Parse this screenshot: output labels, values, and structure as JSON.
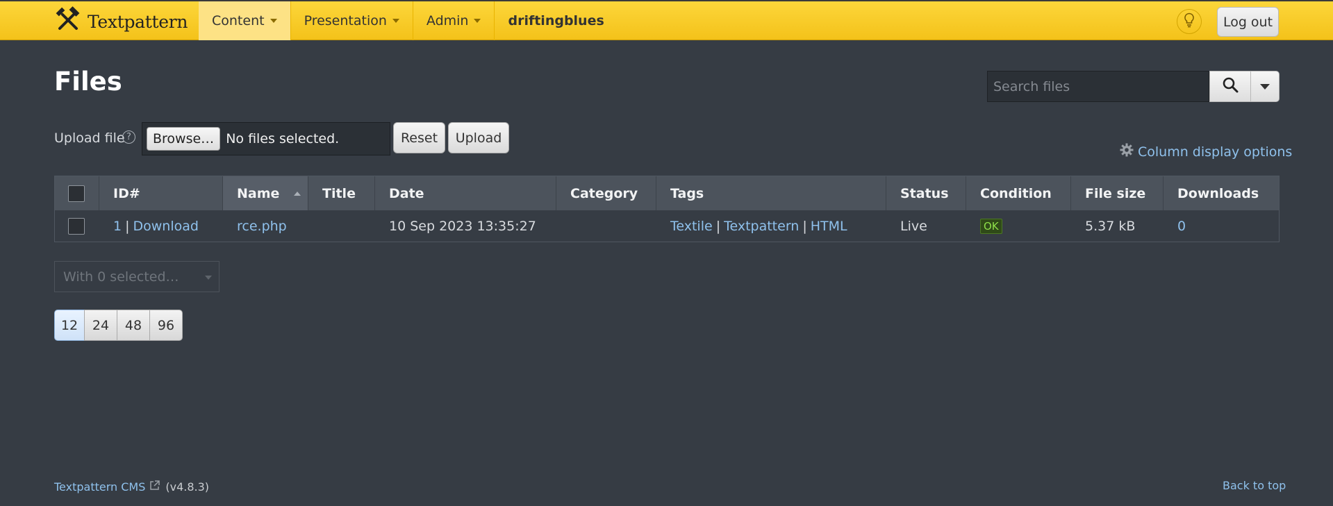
{
  "header": {
    "brand": "Textpattern",
    "nav": [
      {
        "label": "Content"
      },
      {
        "label": "Presentation"
      },
      {
        "label": "Admin"
      }
    ],
    "site_name": "driftingblues",
    "logout_label": "Log out",
    "brand_color": "#f7c61f"
  },
  "page": {
    "title": "Files",
    "search_placeholder": "Search files"
  },
  "upload": {
    "label": "Upload file",
    "help_glyph": "?",
    "browse_label": "Browse…",
    "file_status": "No files selected.",
    "reset_label": "Reset",
    "upload_label": "Upload"
  },
  "column_options_label": "Column display options",
  "table": {
    "columns": [
      "ID#",
      "Name",
      "Title",
      "Date",
      "Category",
      "Tags",
      "Status",
      "Condition",
      "File size",
      "Downloads"
    ],
    "sorted_column": "Name",
    "rows": [
      {
        "id": "1",
        "download_label": "Download",
        "name": "rce.php",
        "title": "",
        "date": "10 Sep 2023 13:35:27",
        "category": "",
        "tags": [
          "Textile",
          "Textpattern",
          "HTML"
        ],
        "status": "Live",
        "condition": "OK",
        "file_size": "5.37 kB",
        "downloads": "0"
      }
    ]
  },
  "bulk_select_label": "With 0 selected…",
  "pagination": {
    "options": [
      "12",
      "24",
      "48",
      "96"
    ],
    "selected": "12"
  },
  "footer": {
    "cms_link": "Textpattern CMS",
    "version": "(v4.8.3)",
    "back_to_top": "Back to top"
  }
}
